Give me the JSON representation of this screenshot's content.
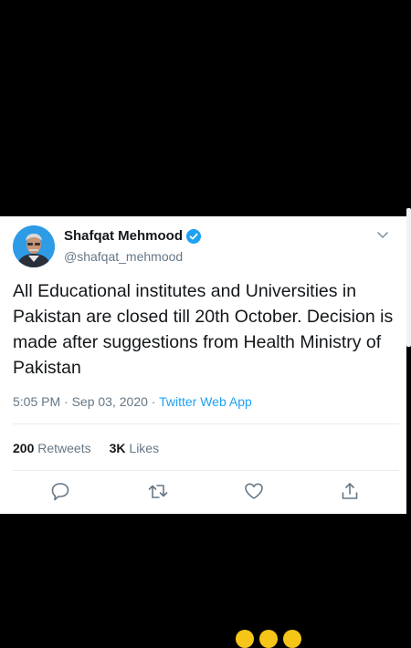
{
  "tweet": {
    "author_name": "Shafqat Mehmood",
    "author_handle": "@shafqat_mehmood",
    "text": "All Educational institutes and Universities in Pakistan are closed till 20th October. Decision is made after suggestions from Health Ministry of Pakistan",
    "time": "5:05 PM",
    "date": "Sep 03, 2020",
    "separator": " · ",
    "source": "Twitter Web App",
    "retweets_count": "200",
    "retweets_label": "Retweets",
    "likes_count": "3K",
    "likes_label": "Likes"
  },
  "icons": {
    "verified": "verified-badge-icon",
    "menu": "chevron-down-icon",
    "reply": "reply-icon",
    "retweet": "retweet-icon",
    "like": "heart-icon",
    "share": "share-icon"
  },
  "colors": {
    "background": "#000000",
    "card": "#ffffff",
    "accent": "#1da1f2",
    "text_primary": "#14171a",
    "text_secondary": "#657786"
  }
}
